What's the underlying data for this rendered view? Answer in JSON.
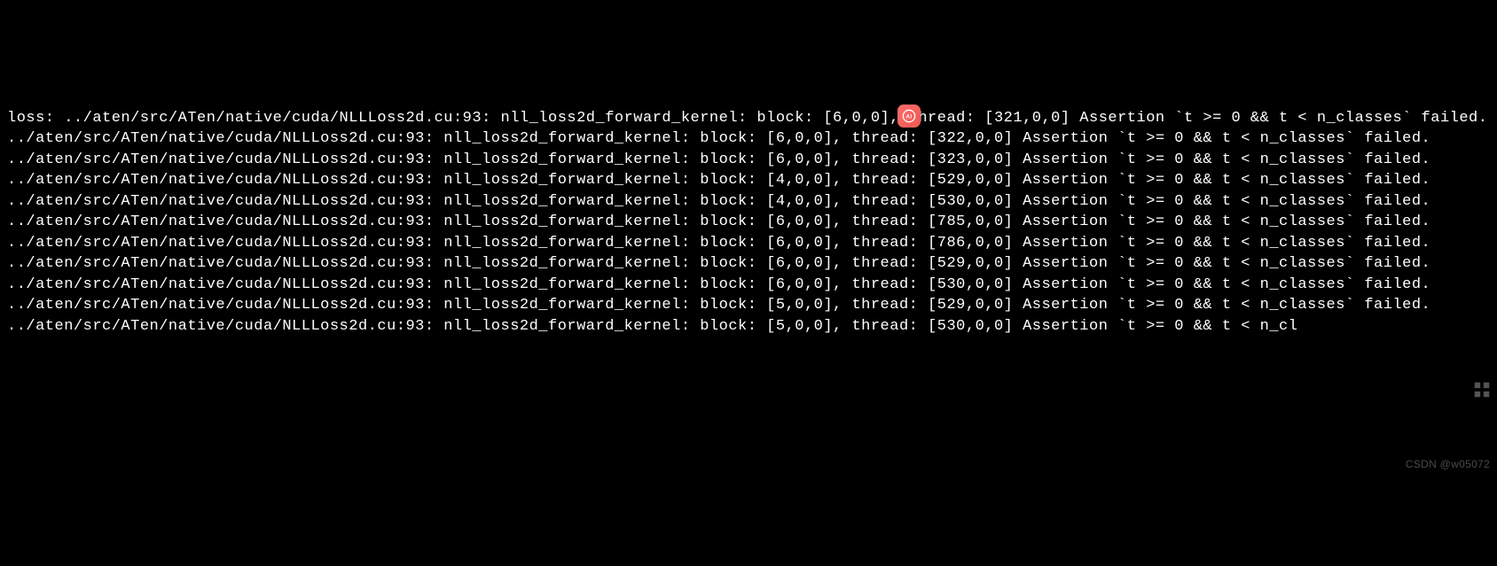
{
  "terminal": {
    "file_path": "../aten/src/ATen/native/cuda/NLLLoss2d.cu",
    "line_no": "93",
    "kernel": "nll_loss2d_forward_kernel",
    "assertion": "`t >= 0 && t < n_classes`",
    "status": "failed.",
    "prefix_loss": "loss: ",
    "lines": [
      {
        "prefix": "loss: ",
        "block": "[6,0,0]",
        "thread": "[321,0,0]",
        "wrap_first": true
      },
      {
        "prefix": "",
        "block": "[6,0,0]",
        "thread": "[322,0,0]",
        "wrap_first": false
      },
      {
        "prefix": "",
        "block": "[6,0,0]",
        "thread": "[323,0,0]",
        "wrap_first": false
      },
      {
        "prefix": "",
        "block": "[4,0,0]",
        "thread": "[529,0,0]",
        "wrap_first": false
      },
      {
        "prefix": "",
        "block": "[4,0,0]",
        "thread": "[530,0,0]",
        "wrap_first": false
      },
      {
        "prefix": "",
        "block": "[6,0,0]",
        "thread": "[785,0,0]",
        "wrap_first": false
      },
      {
        "prefix": "",
        "block": "[6,0,0]",
        "thread": "[786,0,0]",
        "wrap_first": false
      },
      {
        "prefix": "",
        "block": "[6,0,0]",
        "thread": "[529,0,0]",
        "wrap_first": false
      },
      {
        "prefix": "",
        "block": "[6,0,0]",
        "thread": "[530,0,0]",
        "wrap_first": false
      },
      {
        "prefix": "",
        "block": "[5,0,0]",
        "thread": "[529,0,0]",
        "wrap_first": false
      },
      {
        "prefix": "",
        "block": "[5,0,0]",
        "thread": "[530,0,0]",
        "wrap_first": false
      }
    ],
    "first_line_text": "loss: ../aten/src/ATen/native/cuda/NLLLoss2d.cu:93: nll_loss2d_forward_kernel: block: [6,0,0], thread: [321,0,0] Assertion `t >= 0 && t < n_classes` failed.",
    "line_2": "../aten/src/ATen/native/cuda/NLLLoss2d.cu:93: nll_loss2d_forward_kernel: block: [6,0,0], thread: [322,0,0] Assertion `t >= 0 && t < n_classes` failed.",
    "line_3": "../aten/src/ATen/native/cuda/NLLLoss2d.cu:93: nll_loss2d_forward_kernel: block: [6,0,0], thread: [323,0,0] Assertion `t >= 0 && t < n_classes` failed.",
    "line_4": "../aten/src/ATen/native/cuda/NLLLoss2d.cu:93: nll_loss2d_forward_kernel: block: [4,0,0], thread: [529,0,0] Assertion `t >= 0 && t < n_classes` failed.",
    "line_5": "../aten/src/ATen/native/cuda/NLLLoss2d.cu:93: nll_loss2d_forward_kernel: block: [4,0,0], thread: [530,0,0] Assertion `t >= 0 && t < n_classes` failed.",
    "line_6": "../aten/src/ATen/native/cuda/NLLLoss2d.cu:93: nll_loss2d_forward_kernel: block: [6,0,0], thread: [785,0,0] Assertion `t >= 0 && t < n_classes` failed.",
    "line_7": "../aten/src/ATen/native/cuda/NLLLoss2d.cu:93: nll_loss2d_forward_kernel: block: [6,0,0], thread: [786,0,0] Assertion `t >= 0 && t < n_classes` failed.",
    "line_8": "../aten/src/ATen/native/cuda/NLLLoss2d.cu:93: nll_loss2d_forward_kernel: block: [6,0,0], thread: [529,0,0] Assertion `t >= 0 && t < n_classes` failed.",
    "line_9": "../aten/src/ATen/native/cuda/NLLLoss2d.cu:93: nll_loss2d_forward_kernel: block: [6,0,0], thread: [530,0,0] Assertion `t >= 0 && t < n_classes` failed.",
    "line_10": "../aten/src/ATen/native/cuda/NLLLoss2d.cu:93: nll_loss2d_forward_kernel: block: [5,0,0], thread: [529,0,0] Assertion `t >= 0 && t < n_classes` failed.",
    "line_11": "../aten/src/ATen/native/cuda/NLLLoss2d.cu:93: nll_loss2d_forward_kernel: block: [5,0,0], thread: [530,0,0] Assertion `t >= 0 && t < n_cl"
  },
  "badge": {
    "label": "AI"
  },
  "watermark": {
    "text": "CSDN @w05072"
  }
}
